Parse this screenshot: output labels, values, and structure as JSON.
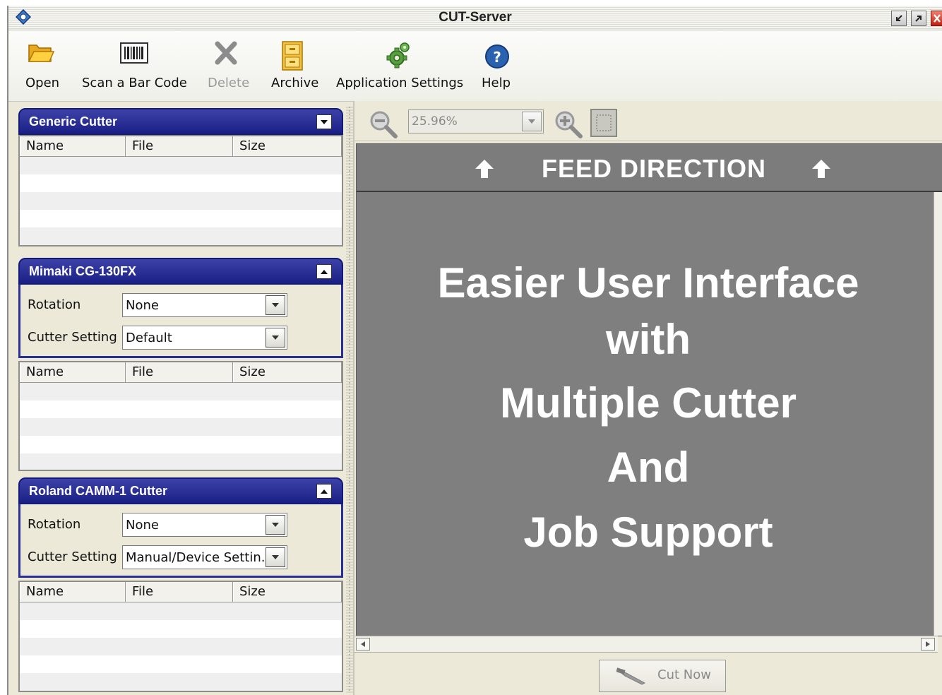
{
  "window": {
    "title": "CUT-Server"
  },
  "toolbar": {
    "items": [
      {
        "label": "Open",
        "icon": "folder-open-icon",
        "enabled": true
      },
      {
        "label": "Scan a Bar Code",
        "icon": "barcode-icon",
        "enabled": true
      },
      {
        "label": "Delete",
        "icon": "delete-x-icon",
        "enabled": false
      },
      {
        "label": "Archive",
        "icon": "archive-cabinet-icon",
        "enabled": true
      },
      {
        "label": "Application Settings",
        "icon": "gear-icon",
        "enabled": true
      },
      {
        "label": "Help",
        "icon": "help-icon",
        "enabled": true
      }
    ]
  },
  "table_columns": [
    "Name",
    "File",
    "Size"
  ],
  "cutters": [
    {
      "name": "Generic Cutter",
      "expanded": false
    },
    {
      "name": "Mimaki CG-130FX",
      "expanded": true,
      "settings": {
        "rotation_label": "Rotation",
        "rotation_value": "None",
        "cutter_setting_label": "Cutter Setting",
        "cutter_setting_value": "Default"
      }
    },
    {
      "name": "Roland CAMM-1 Cutter",
      "expanded": true,
      "settings": {
        "rotation_label": "Rotation",
        "rotation_value": "None",
        "cutter_setting_label": "Cutter Setting",
        "cutter_setting_value": "Manual/Device Settin..."
      }
    }
  ],
  "preview": {
    "zoom_value": "25.96%",
    "feed_direction": "FEED DIRECTION",
    "headline_lines": [
      "Easier User Interface",
      "with",
      "Multiple Cutter",
      "And",
      "Job Support"
    ],
    "cut_now_label": "Cut Now",
    "cut_now_enabled": false
  },
  "colors": {
    "panel_header": "#1a1f86",
    "canvas_bg": "#7f7f7f",
    "window_bg": "#ece9d8"
  }
}
